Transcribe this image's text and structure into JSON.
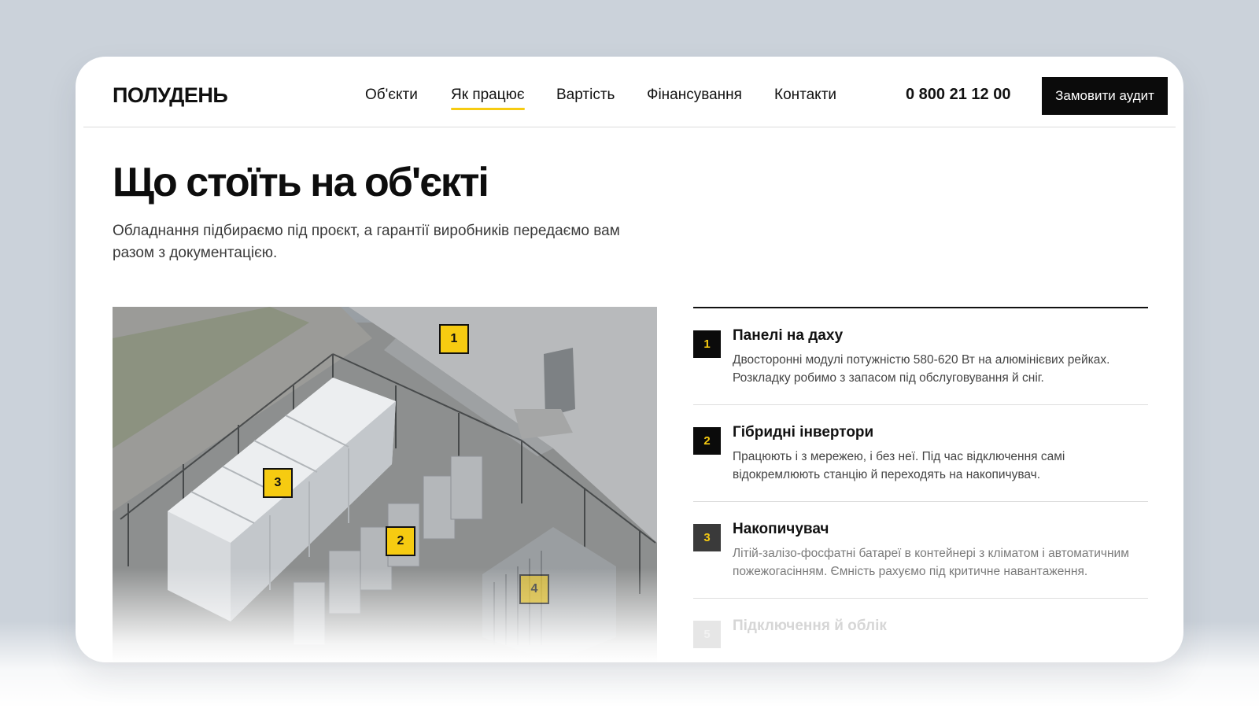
{
  "header": {
    "logo": "ПОЛУДЕНЬ",
    "nav": [
      {
        "label": "Об'єкти",
        "active": false
      },
      {
        "label": "Як працює",
        "active": true
      },
      {
        "label": "Вартість",
        "active": false
      },
      {
        "label": "Фінансування",
        "active": false
      },
      {
        "label": "Контакти",
        "active": false
      }
    ],
    "phone": "0 800 21 12 00",
    "cta_label": "Замовити аудит"
  },
  "main": {
    "title": "Що стоїть на об'єкті",
    "subtitle": "Обладнання підбираємо під проєкт, а гарантії виробників передаємо вам разом з документацією."
  },
  "photo_markers": [
    "1",
    "3",
    "2",
    "4"
  ],
  "items": [
    {
      "num": "1",
      "title": "Панелі на даху",
      "desc": "Двосторонні модулі потужністю 580-620 Вт на алюмінієвих рейках. Розкладку робимо з запасом під обслуговування й сніг."
    },
    {
      "num": "2",
      "title": "Гібридні інвертори",
      "desc": "Працюють і з мережею, і без неї. Під час відключення самі відокремлюють станцію й переходять на накопичувач."
    },
    {
      "num": "3",
      "title": "Накопичувач",
      "desc": "Літій-залізо-фосфатні батареї в контейнері з кліматом і автоматичним пожежогасінням. Ємність рахуємо під критичне навантаження."
    },
    {
      "num": "5",
      "title": "Підключення й облік",
      "desc": ""
    }
  ],
  "colors": {
    "accent": "#f6cb11",
    "dark": "#0b0b0b",
    "background": "#cbd2da"
  }
}
